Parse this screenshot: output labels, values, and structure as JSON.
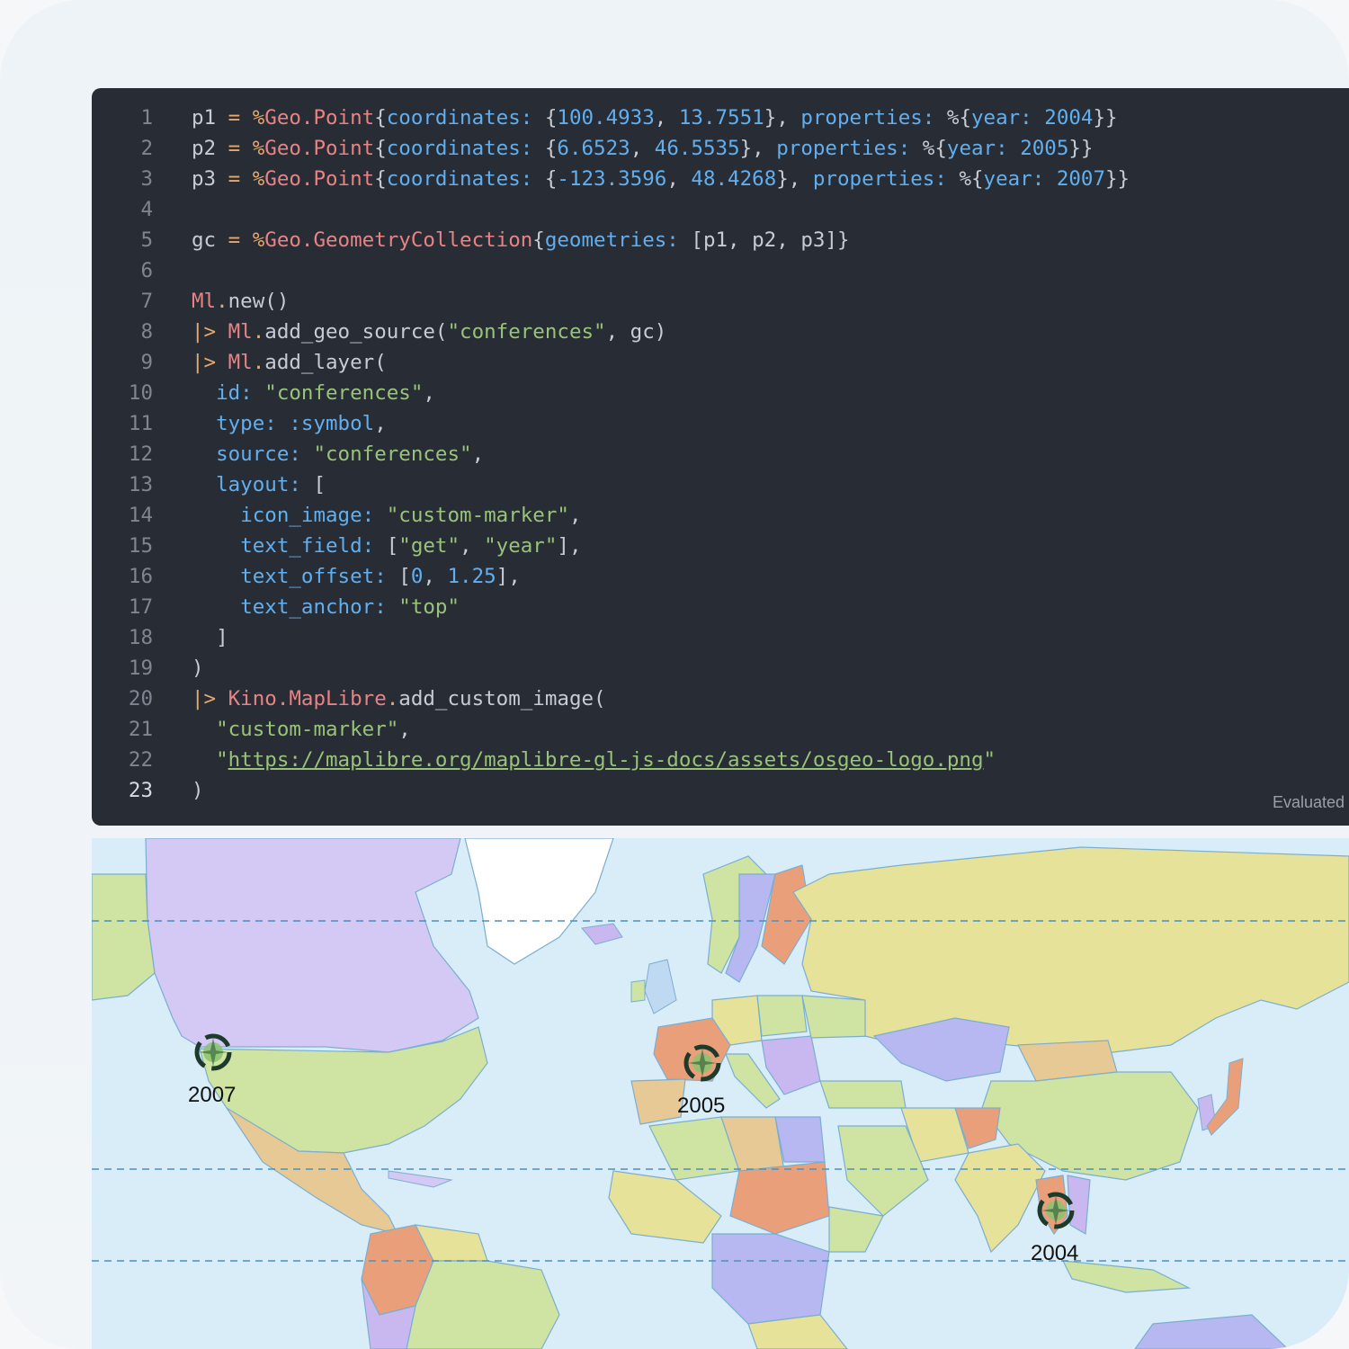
{
  "editor": {
    "lines": [
      {
        "n": "1",
        "tokens": [
          [
            "plain",
            "p1 "
          ],
          [
            "op",
            "="
          ],
          [
            "plain",
            " "
          ],
          [
            "op",
            "%"
          ],
          [
            "mod",
            "Geo.Point"
          ],
          [
            "plain",
            "{"
          ],
          [
            "key",
            "coordinates:"
          ],
          [
            "plain",
            " {"
          ],
          [
            "num",
            "100.4933"
          ],
          [
            "plain",
            ", "
          ],
          [
            "num",
            "13.7551"
          ],
          [
            "plain",
            "}, "
          ],
          [
            "key",
            "properties:"
          ],
          [
            "plain",
            " %{"
          ],
          [
            "key",
            "year:"
          ],
          [
            "plain",
            " "
          ],
          [
            "num",
            "2004"
          ],
          [
            "plain",
            "}}"
          ]
        ]
      },
      {
        "n": "2",
        "tokens": [
          [
            "plain",
            "p2 "
          ],
          [
            "op",
            "="
          ],
          [
            "plain",
            " "
          ],
          [
            "op",
            "%"
          ],
          [
            "mod",
            "Geo.Point"
          ],
          [
            "plain",
            "{"
          ],
          [
            "key",
            "coordinates:"
          ],
          [
            "plain",
            " {"
          ],
          [
            "num",
            "6.6523"
          ],
          [
            "plain",
            ", "
          ],
          [
            "num",
            "46.5535"
          ],
          [
            "plain",
            "}, "
          ],
          [
            "key",
            "properties:"
          ],
          [
            "plain",
            " %{"
          ],
          [
            "key",
            "year:"
          ],
          [
            "plain",
            " "
          ],
          [
            "num",
            "2005"
          ],
          [
            "plain",
            "}}"
          ]
        ]
      },
      {
        "n": "3",
        "tokens": [
          [
            "plain",
            "p3 "
          ],
          [
            "op",
            "="
          ],
          [
            "plain",
            " "
          ],
          [
            "op",
            "%"
          ],
          [
            "mod",
            "Geo.Point"
          ],
          [
            "plain",
            "{"
          ],
          [
            "key",
            "coordinates:"
          ],
          [
            "plain",
            " {"
          ],
          [
            "num",
            "-123.3596"
          ],
          [
            "plain",
            ", "
          ],
          [
            "num",
            "48.4268"
          ],
          [
            "plain",
            "}, "
          ],
          [
            "key",
            "properties:"
          ],
          [
            "plain",
            " %{"
          ],
          [
            "key",
            "year:"
          ],
          [
            "plain",
            " "
          ],
          [
            "num",
            "2007"
          ],
          [
            "plain",
            "}}"
          ]
        ]
      },
      {
        "n": "4",
        "tokens": []
      },
      {
        "n": "5",
        "tokens": [
          [
            "plain",
            "gc "
          ],
          [
            "op",
            "="
          ],
          [
            "plain",
            " "
          ],
          [
            "op",
            "%"
          ],
          [
            "mod",
            "Geo.GeometryCollection"
          ],
          [
            "plain",
            "{"
          ],
          [
            "key",
            "geometries:"
          ],
          [
            "plain",
            " [p1, p2, p3]}"
          ]
        ]
      },
      {
        "n": "6",
        "tokens": []
      },
      {
        "n": "7",
        "tokens": [
          [
            "mod",
            "Ml"
          ],
          [
            "op",
            "."
          ],
          [
            "plain",
            "new()"
          ]
        ]
      },
      {
        "n": "8",
        "tokens": [
          [
            "op",
            "|>"
          ],
          [
            "plain",
            " "
          ],
          [
            "mod",
            "Ml"
          ],
          [
            "op",
            "."
          ],
          [
            "plain",
            "add_geo_source("
          ],
          [
            "str",
            "\"conferences\""
          ],
          [
            "plain",
            ", gc)"
          ]
        ]
      },
      {
        "n": "9",
        "tokens": [
          [
            "op",
            "|>"
          ],
          [
            "plain",
            " "
          ],
          [
            "mod",
            "Ml"
          ],
          [
            "op",
            "."
          ],
          [
            "plain",
            "add_layer("
          ]
        ]
      },
      {
        "n": "10",
        "tokens": [
          [
            "plain",
            "  "
          ],
          [
            "key",
            "id:"
          ],
          [
            "plain",
            " "
          ],
          [
            "str",
            "\"conferences\""
          ],
          [
            "plain",
            ","
          ]
        ]
      },
      {
        "n": "11",
        "tokens": [
          [
            "plain",
            "  "
          ],
          [
            "key",
            "type:"
          ],
          [
            "plain",
            " "
          ],
          [
            "key",
            ":symbol"
          ],
          [
            "plain",
            ","
          ]
        ]
      },
      {
        "n": "12",
        "tokens": [
          [
            "plain",
            "  "
          ],
          [
            "key",
            "source:"
          ],
          [
            "plain",
            " "
          ],
          [
            "str",
            "\"conferences\""
          ],
          [
            "plain",
            ","
          ]
        ]
      },
      {
        "n": "13",
        "tokens": [
          [
            "plain",
            "  "
          ],
          [
            "key",
            "layout:"
          ],
          [
            "plain",
            " ["
          ]
        ]
      },
      {
        "n": "14",
        "tokens": [
          [
            "plain",
            "    "
          ],
          [
            "key",
            "icon_image:"
          ],
          [
            "plain",
            " "
          ],
          [
            "str",
            "\"custom-marker\""
          ],
          [
            "plain",
            ","
          ]
        ]
      },
      {
        "n": "15",
        "tokens": [
          [
            "plain",
            "    "
          ],
          [
            "key",
            "text_field:"
          ],
          [
            "plain",
            " ["
          ],
          [
            "str",
            "\"get\""
          ],
          [
            "plain",
            ", "
          ],
          [
            "str",
            "\"year\""
          ],
          [
            "plain",
            "],"
          ]
        ]
      },
      {
        "n": "16",
        "tokens": [
          [
            "plain",
            "    "
          ],
          [
            "key",
            "text_offset:"
          ],
          [
            "plain",
            " ["
          ],
          [
            "num",
            "0"
          ],
          [
            "plain",
            ", "
          ],
          [
            "num",
            "1.25"
          ],
          [
            "plain",
            "],"
          ]
        ]
      },
      {
        "n": "17",
        "tokens": [
          [
            "plain",
            "    "
          ],
          [
            "key",
            "text_anchor:"
          ],
          [
            "plain",
            " "
          ],
          [
            "str",
            "\"top\""
          ]
        ]
      },
      {
        "n": "18",
        "tokens": [
          [
            "plain",
            "  ]"
          ]
        ]
      },
      {
        "n": "19",
        "tokens": [
          [
            "plain",
            ")"
          ]
        ]
      },
      {
        "n": "20",
        "tokens": [
          [
            "op",
            "|>"
          ],
          [
            "plain",
            " "
          ],
          [
            "mod",
            "Kino.MapLibre"
          ],
          [
            "op",
            "."
          ],
          [
            "plain",
            "add_custom_image("
          ]
        ]
      },
      {
        "n": "21",
        "tokens": [
          [
            "plain",
            "  "
          ],
          [
            "str",
            "\"custom-marker\""
          ],
          [
            "plain",
            ","
          ]
        ]
      },
      {
        "n": "22",
        "tokens": [
          [
            "plain",
            "  "
          ],
          [
            "str",
            "\""
          ],
          [
            "link",
            "https://maplibre.org/maplibre-gl-js-docs/assets/osgeo-logo.png"
          ],
          [
            "str",
            "\""
          ]
        ]
      },
      {
        "n": "23",
        "tokens": [
          [
            "plain",
            ")"
          ]
        ]
      }
    ],
    "current_line": "23",
    "status": "Evaluated"
  },
  "map": {
    "markers": [
      {
        "label": "2007",
        "icon": "osgeo-marker-icon"
      },
      {
        "label": "2005",
        "icon": "osgeo-marker-icon"
      },
      {
        "label": "2004",
        "icon": "osgeo-marker-icon"
      }
    ],
    "colors": {
      "ocean": "#d9edf8",
      "greenland": "#ffffff",
      "canada_usa": "#d4c8f5",
      "usa": "#cfe3a3",
      "russia": "#e8e29a",
      "china": "#cfe3a3",
      "grid_line": "#4a90c0"
    }
  }
}
